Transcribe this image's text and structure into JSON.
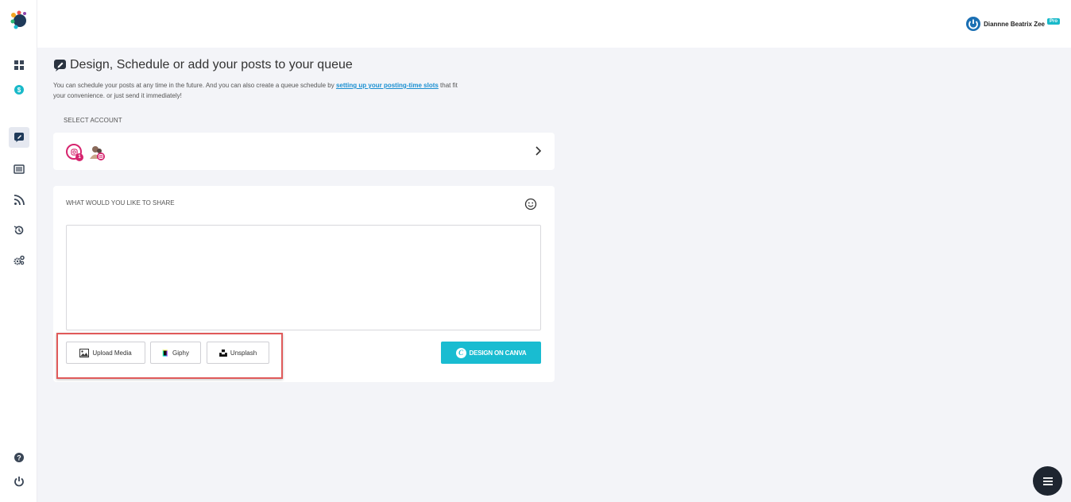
{
  "header": {
    "user_name": "Diannne Beatrix Zee",
    "badge": "Pro"
  },
  "sidebar": {
    "items": [
      {
        "icon": "dashboard-icon"
      },
      {
        "icon": "dollar-icon"
      },
      {
        "icon": "compose-icon",
        "active": true
      },
      {
        "icon": "list-icon"
      },
      {
        "icon": "rss-icon"
      },
      {
        "icon": "history-icon"
      },
      {
        "icon": "settings-icon"
      }
    ],
    "bottom": [
      {
        "icon": "help-icon"
      },
      {
        "icon": "power-icon"
      }
    ]
  },
  "main": {
    "title": "Design, Schedule or add your posts to your queue",
    "description_before": "You can schedule your posts at any time in the future. And you can also create a queue schedule by ",
    "description_link": "setting up your posting-time slots",
    "description_after": " that fit your convenience. or just send it immediately!",
    "select_account_label": "SELECT ACCOUNT",
    "account_count": "1",
    "share_label": "WHAT WOULD YOU LIKE TO SHARE",
    "share_value": "",
    "buttons": {
      "upload": "Upload Media",
      "giphy": "Giphy",
      "unsplash": "Unsplash",
      "canva": "DESIGN ON CANVA"
    }
  },
  "colors": {
    "accent": "#19bcd1",
    "instagram": "#d6246e",
    "highlight": "#e05a5a",
    "link": "#1a8fd1"
  }
}
